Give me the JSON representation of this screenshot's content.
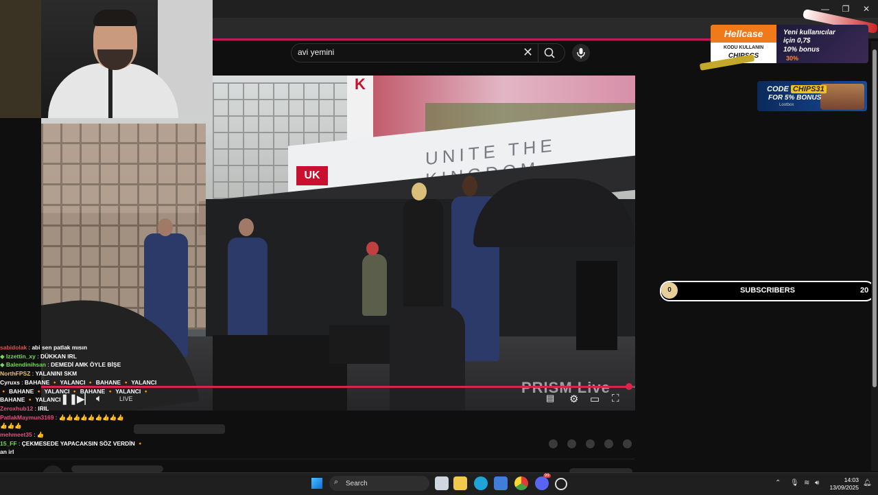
{
  "browser": {
    "window_controls": [
      "—",
      "❐",
      "✕"
    ]
  },
  "search": {
    "query": "avi yemini",
    "clear_icon": "close-icon",
    "search_icon": "search-icon",
    "mic_icon": "mic-icon"
  },
  "video": {
    "progress_fraction": 0.99,
    "live_label": "LIVE",
    "watermark": "PRISM Live",
    "banner_logo": "UK",
    "banner_text": "UNITE THE KINGDOM",
    "uk_sign": "K"
  },
  "chat": [
    {
      "user": "sabidolak",
      "user_color": "#e05050",
      "message": "abi sen patlak mısın",
      "icon": ""
    },
    {
      "user": "Izzettin_xy",
      "user_color": "#7ad85a",
      "message": "DÜKKAN IRL",
      "icon": "◆"
    },
    {
      "user": "Balendinihsan",
      "user_color": "#7ad85a",
      "message": "DEMEDİ AMK ÖYLE BİŞE",
      "icon": "◆"
    },
    {
      "user": "NorthFPSZ",
      "user_color": "#e8c070",
      "message": "YALANINI SKM",
      "icon": ""
    },
    {
      "user": "Cyruxs",
      "user_color": "#ffffff",
      "message": "BAHANE 🔸 YALANCI 🔸 BAHANE 🔸 YALANCI",
      "icon": ""
    },
    {
      "user": "",
      "user_color": "#ffffff",
      "message": "🔸 BAHANE 🔸 YALANCI 🔸 BAHANE 🔸 YALANCI 🔸",
      "icon": ""
    },
    {
      "user": "",
      "user_color": "#ffffff",
      "message": "BAHANE 🔸 YALANCI",
      "icon": ""
    },
    {
      "user": "Zeroxhub12",
      "user_color": "#e05080",
      "message": "IRIL",
      "icon": ""
    },
    {
      "user": "PatlakMaymun3169",
      "user_color": "#e05080",
      "message": "👍👍👍👍👍👍👍👍👍",
      "icon": ""
    },
    {
      "user": "",
      "user_color": "#ffffff",
      "message": "👍👍👍",
      "icon": ""
    },
    {
      "user": "mehmeet35",
      "user_color": "#e05080",
      "message": "👍",
      "icon": ""
    },
    {
      "user": "15_FF",
      "user_color": "#7ad85a",
      "message": "ÇEKMESEDE YAPACAKSIN SÖZ VERDİN 🔸",
      "icon": ""
    },
    {
      "user": "",
      "user_color": "#ffffff",
      "message": "an irl",
      "icon": ""
    }
  ],
  "ads": {
    "hellcase": {
      "brand": "Hellcase",
      "code_line1": "KODU KULLANIN",
      "code_line2": "CHIPSCS",
      "line1": "Yeni kullanıcılar",
      "line2": "için 0,7$",
      "line3": "10% bonus",
      "line4": "30%"
    },
    "chips": {
      "code_prefix": "CODE",
      "code": "CHIPS31",
      "bonus": "FOR 5% BONUS",
      "brand": "Lootbox"
    }
  },
  "subscribers": {
    "current": "0",
    "label": "SUBSCRIBERS",
    "goal": "20",
    "progress_fraction": 0
  },
  "taskbar": {
    "search_label": "Search",
    "time": "14:03",
    "date": "13/09/2025",
    "apps": [
      "file-explorer-icon",
      "edge-icon",
      "store-icon",
      "chrome-icon",
      "discord-icon",
      "app-icon"
    ],
    "discord_badge": "99"
  },
  "colors": {
    "accent": "#e0224a",
    "hellcase_orange": "#f07a1a"
  }
}
